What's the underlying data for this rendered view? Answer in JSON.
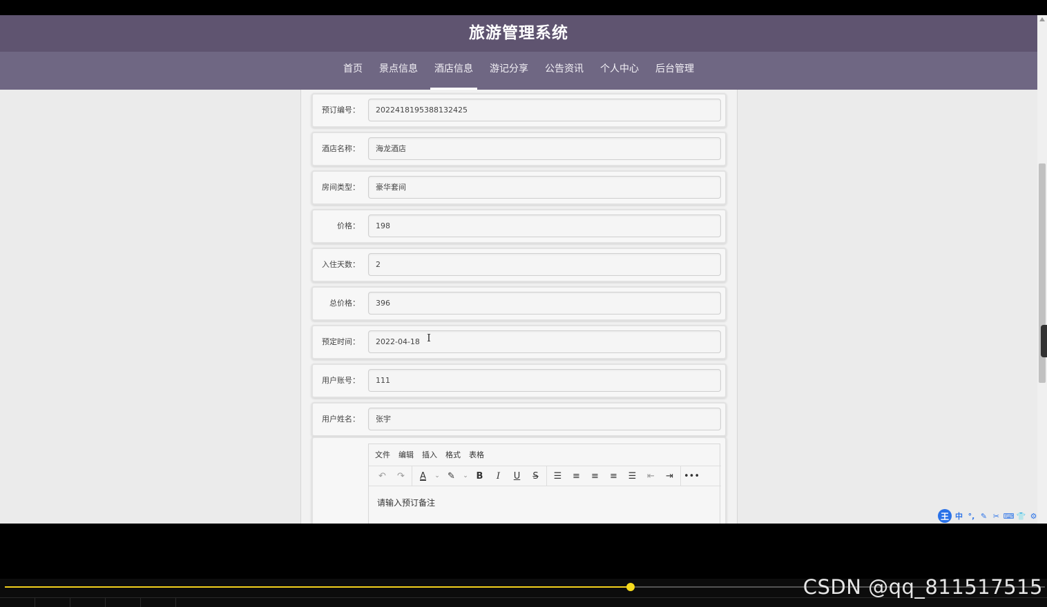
{
  "header": {
    "title": "旅游管理系统"
  },
  "nav": {
    "items": [
      {
        "label": "首页"
      },
      {
        "label": "景点信息"
      },
      {
        "label": "酒店信息"
      },
      {
        "label": "游记分享"
      },
      {
        "label": "公告资讯"
      },
      {
        "label": "个人中心"
      },
      {
        "label": "后台管理"
      }
    ],
    "active": "酒店信息"
  },
  "form": {
    "fields": [
      {
        "label": "预订编号：",
        "value": "2022418195388132425"
      },
      {
        "label": "酒店名称：",
        "value": "海龙酒店"
      },
      {
        "label": "房间类型：",
        "value": "豪华套间"
      },
      {
        "label": "价格：",
        "value": "198"
      },
      {
        "label": "入住天数：",
        "value": "2"
      },
      {
        "label": "总价格：",
        "value": "396"
      },
      {
        "label": "预定时间：",
        "value": "2022-04-18"
      },
      {
        "label": "用户账号：",
        "value": "111"
      },
      {
        "label": "用户姓名：",
        "value": "张宇"
      }
    ]
  },
  "editor": {
    "menu": [
      "文件",
      "编辑",
      "插入",
      "格式",
      "表格"
    ],
    "placeholder": "请输入预订备注",
    "toolbar_icons": [
      "undo-icon",
      "redo-icon",
      "text-color-icon",
      "highlight-icon",
      "bold-icon",
      "italic-icon",
      "underline-icon",
      "strikethrough-icon",
      "line-height-icon",
      "align-left-icon",
      "align-center-icon",
      "align-right-icon",
      "align-justify-icon",
      "outdent-icon",
      "indent-icon",
      "more-icon"
    ]
  },
  "ime": {
    "logo": "王",
    "mode": "中"
  },
  "player": {
    "progress": 0.6,
    "watermark": "CSDN @qq_811517515"
  },
  "colors": {
    "header": "#5f5470",
    "nav": "#6f6783",
    "progress": "#f3d11c"
  }
}
